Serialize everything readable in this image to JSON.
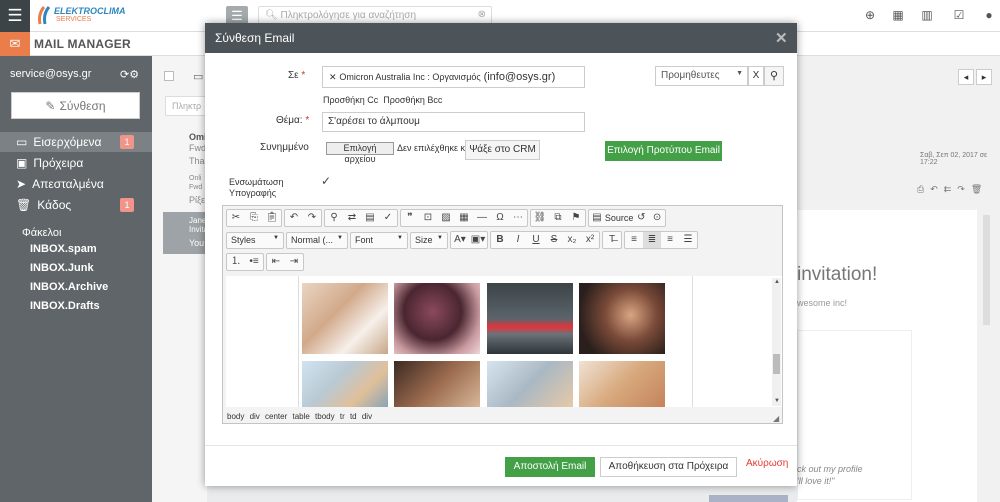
{
  "topbar": {
    "brand_line1": "ELEKTROCLIMA",
    "brand_line2": "SERVICES",
    "search_placeholder": "Πληκτρολόγησε για αναζήτηση"
  },
  "app": {
    "title": "MAIL MANAGER"
  },
  "sidebar": {
    "account": "service@osys.gr",
    "compose": "Σύνθεση",
    "items": [
      {
        "label": "Εισερχόμενα",
        "badge": "1"
      },
      {
        "label": "Πρόχειρα"
      },
      {
        "label": "Απεσταλμένα"
      },
      {
        "label": "Κάδος",
        "badge": "1"
      }
    ],
    "folders_heading": "Φάκελοι",
    "folders": [
      "INBOX.spam",
      "INBOX.Junk",
      "INBOX.Archive",
      "INBOX.Drafts"
    ]
  },
  "background": {
    "list_search": "Πληκτρ",
    "rows": [
      "Omi",
      "Fwd",
      "Thar",
      "Onli",
      "Fwd",
      "Ρίξε",
      "Jane",
      "Invitatio",
      "You"
    ],
    "date": "Σαβ, Σεπ 02, 2017 σε 17:22",
    "invitation": "invitation!",
    "awesome": "wesome inc!",
    "quote1": "ck out my profile",
    "quote2": "'ll love it!\""
  },
  "modal": {
    "title": "Σύνθεση Email",
    "to_label": "Σε",
    "recipient": "Omicron Australia Inc : Οργανισμός",
    "recipient_email": "(info@osys.gr)",
    "suppliers_select": "Προμηθευτες",
    "clear_x": "X",
    "add_cc": "Προσθήκη Cc",
    "add_bcc": "Προσθήκη Bcc",
    "subject_label": "Θέμα:",
    "subject_value": "Σ'αρέσει το άλμπουμ",
    "attachment_label": "Συνημμένο",
    "file_button": "Επιλογή αρχείου",
    "file_status": "Δεν επιλέχθηκε κα",
    "crm_button": "Ψάξε στο CRM",
    "template_button": "Επιλογή Προτύπου Email",
    "signature_label_1": "Ενσωμάτωση",
    "signature_label_2": "Υπογραφής",
    "signature_check": "✓",
    "send_button": "Αποστολή Email",
    "draft_button": "Αποθήκευση στα Πρόχειρα",
    "cancel_button": "Ακύρωση"
  },
  "editor": {
    "source_label": "Source",
    "styles": "Styles",
    "format": "Normal (...",
    "font": "Font",
    "size": "Size",
    "path": "body div center table tbody tr td div"
  }
}
